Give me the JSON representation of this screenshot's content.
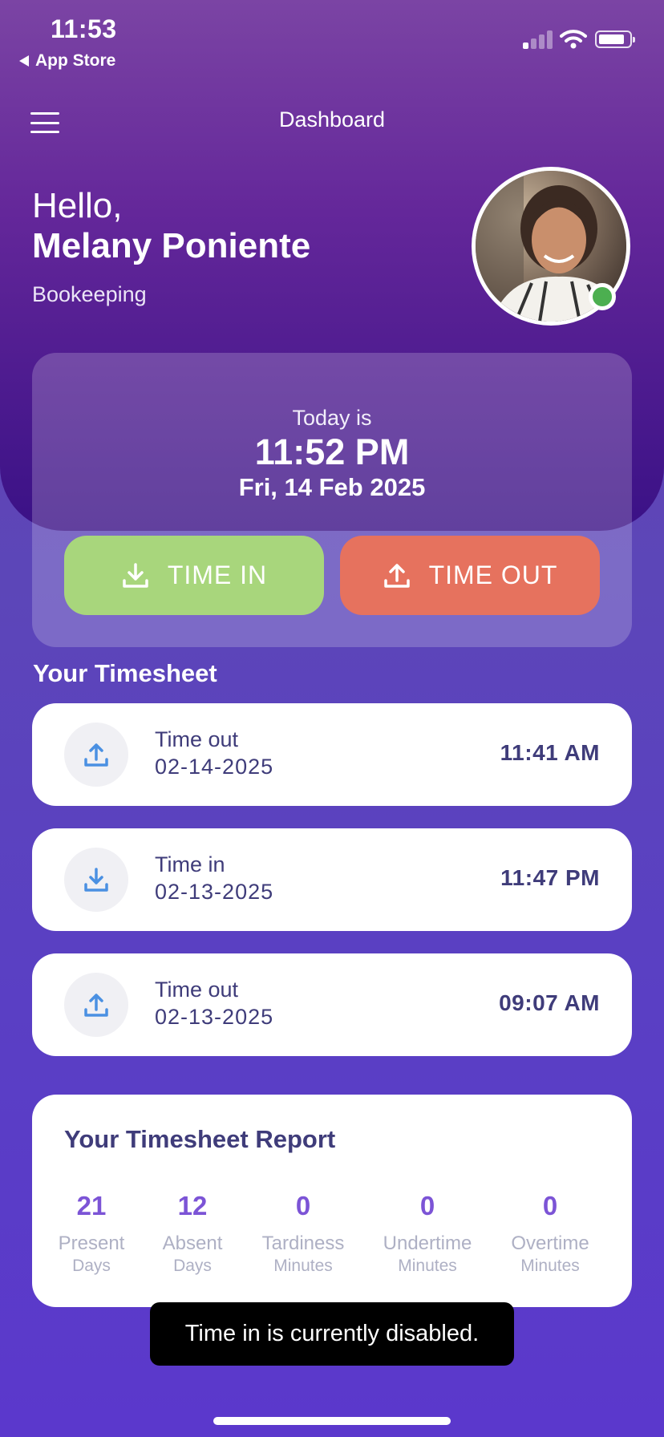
{
  "status_bar": {
    "time": "11:53",
    "back_app": "App Store"
  },
  "header": {
    "title": "Dashboard",
    "menu_icon": "hamburger-menu-icon"
  },
  "greeting": {
    "hello": "Hello,",
    "name": "Melany Poniente",
    "department": "Bookeeping",
    "online": true
  },
  "clock": {
    "label": "Today is",
    "time": "11:52 PM",
    "date": "Fri, 14 Feb 2025"
  },
  "actions": {
    "time_in": {
      "label": "TIME IN",
      "icon": "download-icon",
      "color": "#a8d67c"
    },
    "time_out": {
      "label": "TIME OUT",
      "icon": "upload-icon",
      "color": "#e6725e"
    }
  },
  "timesheet": {
    "title": "Your Timesheet",
    "entries": [
      {
        "type": "Time out",
        "date": "02-14-2025",
        "time": "11:41 AM",
        "icon": "upload-icon"
      },
      {
        "type": "Time in",
        "date": "02-13-2025",
        "time": "11:47 PM",
        "icon": "download-icon"
      },
      {
        "type": "Time out",
        "date": "02-13-2025",
        "time": "09:07 AM",
        "icon": "upload-icon"
      }
    ]
  },
  "report": {
    "title": "Your Timesheet Report",
    "stats": [
      {
        "value": "21",
        "label": "Present",
        "unit": "Days"
      },
      {
        "value": "12",
        "label": "Absent",
        "unit": "Days"
      },
      {
        "value": "0",
        "label": "Tardiness",
        "unit": "Minutes"
      },
      {
        "value": "0",
        "label": "Undertime",
        "unit": "Minutes"
      },
      {
        "value": "0",
        "label": "Overtime",
        "unit": "Minutes"
      }
    ]
  },
  "toast": {
    "message": "Time in is currently disabled."
  },
  "colors": {
    "accent": "#7c54d6",
    "text_dark": "#3f3c7a",
    "online": "#4caf50"
  }
}
